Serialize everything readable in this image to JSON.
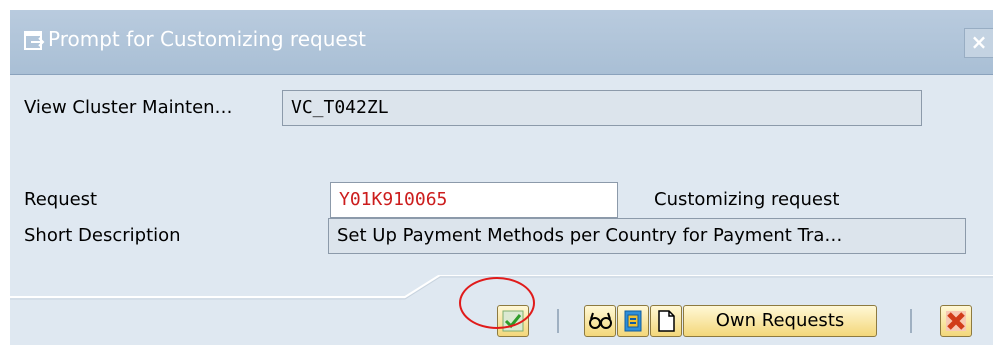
{
  "dialog": {
    "title": "Prompt for Customizing request",
    "close_glyph": "×"
  },
  "fields": {
    "view_cluster_label": "View Cluster Mainten…",
    "view_cluster_value": "VC_T042ZL",
    "request_label": "Request",
    "request_value": "Y01K910065",
    "request_type": "Customizing request",
    "short_desc_label": "Short Description",
    "short_desc_value": "Set Up Payment Methods per Country for Payment Tra…"
  },
  "toolbar": {
    "own_requests_label": "Own Requests"
  },
  "colors": {
    "request_value": "#cc1d1d",
    "highlight": "#e01b1b",
    "cancel": "#d13d1a",
    "confirm": "#2e9c2a"
  },
  "icons": [
    "dialog-icon",
    "checkmark-icon",
    "glasses-icon",
    "request-icon",
    "new-document-icon",
    "cancel-icon",
    "close-icon"
  ]
}
